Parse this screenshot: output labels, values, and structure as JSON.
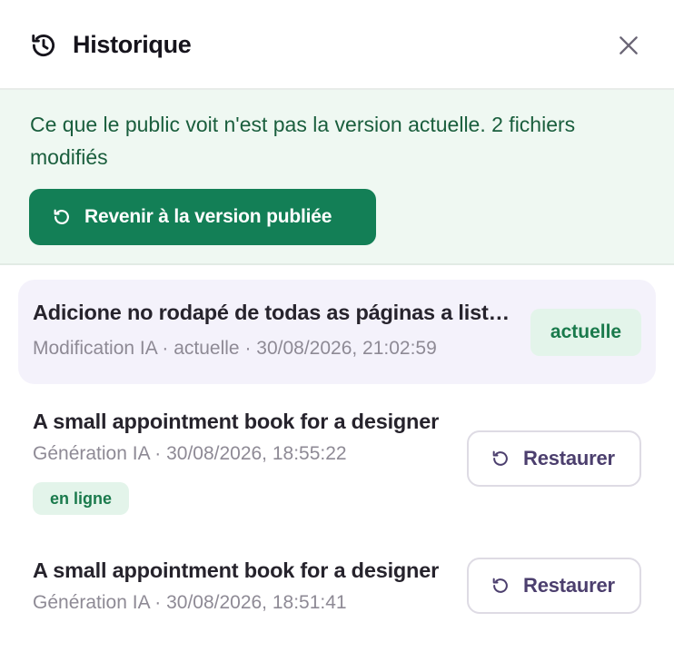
{
  "header": {
    "title": "Historique",
    "icon": "history-icon",
    "close_icon": "close-icon"
  },
  "notice": {
    "text": "Ce que le public voit n'est pas la version actuelle. 2 fichiers modifiés",
    "revert_label": "Revenir à la version publiée"
  },
  "entries": [
    {
      "title": "Adicione no rodapé de todas as páginas a lista de projetos",
      "meta": "Modification IA · actuelle · 30/08/2026, 21:02:59",
      "badge": "actuelle",
      "is_current": true
    },
    {
      "title": "A small appointment book for a designer",
      "meta": "Génération IA · 30/08/2026, 18:55:22",
      "badge": "en ligne",
      "restore_label": "Restaurer"
    },
    {
      "title": "A small appointment book for a designer",
      "meta": "Génération IA · 30/08/2026, 18:51:41",
      "restore_label": "Restaurer"
    }
  ],
  "colors": {
    "primary_green": "#137f56",
    "notice_bg": "#eff8f2",
    "current_bg": "#f4f2fb",
    "restore_text": "#4c3f6e"
  }
}
